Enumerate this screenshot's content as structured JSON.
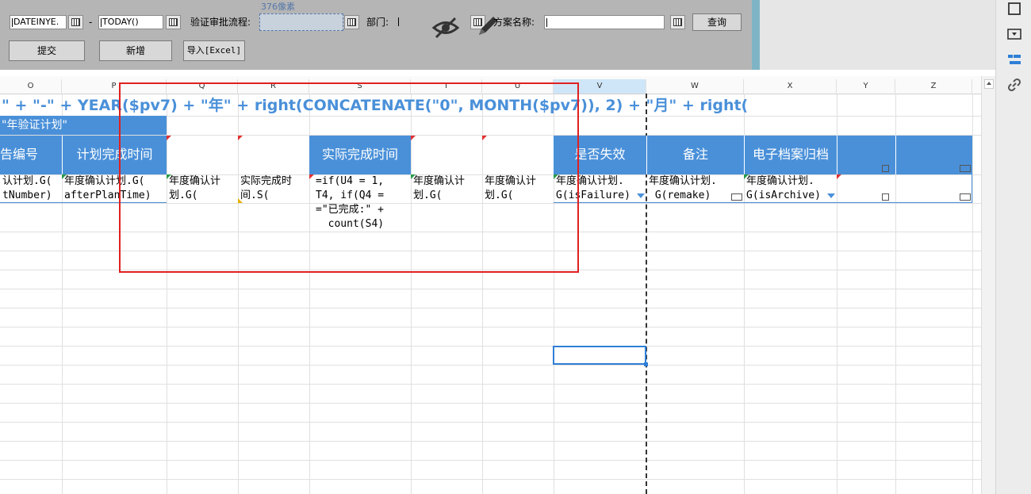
{
  "params": {
    "start_date_value": "DATEINYE.",
    "date_separator": "-",
    "end_date_value": "TODAY()",
    "approval_flow_label": "验证审批流程:",
    "width_hint": "376像素",
    "dept_label": "部门:",
    "scheme_label": "方案名称:",
    "query_button": "查询",
    "submit_button": "提交",
    "add_button": "新增",
    "import_button": "导入[Excel]"
  },
  "columns": [
    "O",
    "P",
    "Q",
    "R",
    "S",
    "T",
    "U",
    "V",
    "W",
    "X",
    "Y",
    "Z"
  ],
  "sheet": {
    "formula_title": "\" + \"-\" + YEAR($pv7) + \"年\" + right(CONCATENATE(\"0\", MONTH($pv7)), 2) + \"月\" + right(",
    "subtitle": "\"年验证计划\"",
    "headers": {
      "o": "告编号",
      "p": "计划完成时间",
      "s": "实际完成时间",
      "v": "是否失效",
      "w": "备注",
      "x": "电子档案归档"
    },
    "row4": {
      "o": "认计划.G(\ntNumber)",
      "p": "年度确认计划.G(\nafterPlanTime)",
      "q": "年度确认计\n划.G(",
      "r": "实际完成时\n间.S(",
      "s": "=if(U4 = 1,\nT4, if(Q4 =\n=\"已完成:\" +\n  count(S4)",
      "t": "年度确认计\n划.G(",
      "u": "年度确认计\n划.G(",
      "v": "年度确认计划.\nG(isFailure)",
      "w": "年度确认计划.\n G(remake)",
      "x": "年度确认计划.\nG(isArchive)"
    }
  },
  "colors": {
    "header_blue": "#4a90d9",
    "formula_text": "#4a90d9",
    "highlight_red": "#e02020",
    "selection_blue": "#2f7fd6"
  }
}
